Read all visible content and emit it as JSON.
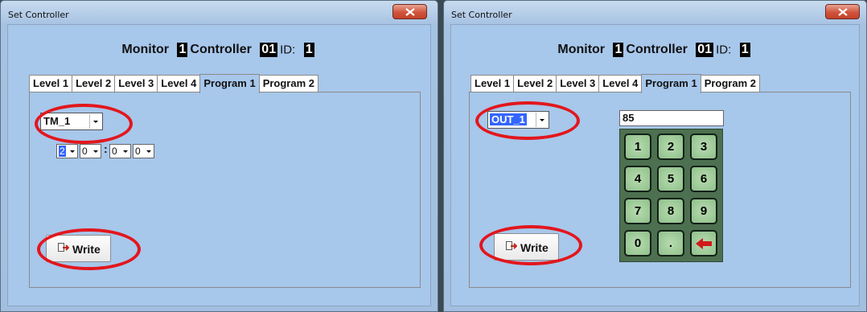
{
  "left_window": {
    "title": "Set Controller",
    "header": {
      "monitor": "Monitor",
      "monitor_num": "1",
      "controller": "Controller",
      "controller_num": "01",
      "id_label": "ID:",
      "id_num": "1"
    },
    "tabs": [
      "Level 1",
      "Level 2",
      "Level 3",
      "Level 4",
      "Program 1",
      "Program 2"
    ],
    "active_tab": "Program 1",
    "combo": {
      "value": "TM_1"
    },
    "time_fields": [
      "2",
      "0",
      "0",
      "0"
    ],
    "time_separator": ":",
    "write_button": "Write"
  },
  "right_window": {
    "title": "Set Controller",
    "header": {
      "monitor": "Monitor",
      "monitor_num": "1",
      "controller": "Controller",
      "controller_num": "01",
      "id_label": "ID:",
      "id_num": "1"
    },
    "tabs": [
      "Level 1",
      "Level 2",
      "Level 3",
      "Level 4",
      "Program 1",
      "Program 2"
    ],
    "active_tab": "Program 1",
    "combo": {
      "value": "OUT_1"
    },
    "display_value": "85",
    "keypad": [
      "1",
      "2",
      "3",
      "4",
      "5",
      "6",
      "7",
      "8",
      "9",
      "0",
      "."
    ],
    "backspace_icon": "left-arrow-icon",
    "write_button": "Write"
  },
  "colors": {
    "highlight_ring": "#e3161c",
    "client_bg": "#a7c7eb",
    "keypad_bg": "#4d7050",
    "key_face": "#9fcc98",
    "selection": "#3366ff"
  }
}
